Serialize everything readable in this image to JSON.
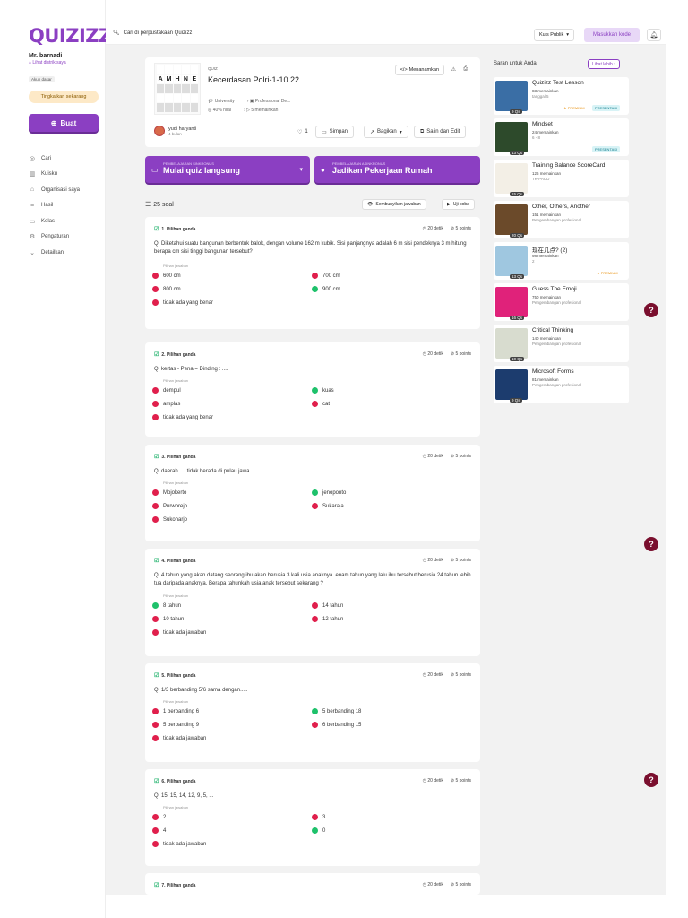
{
  "brand": {
    "logo": "QUIZIZZ"
  },
  "user": {
    "name": "Mr. barnadi",
    "district_link": "Lihat distrik saya",
    "account_type": "Akun dasar",
    "upgrade_label": "Tingkatkan sekarang"
  },
  "sidebar": {
    "create_label": "Buat",
    "items": [
      {
        "label": "Cari",
        "icon": "compass-icon"
      },
      {
        "label": "Kuisku",
        "icon": "library-icon"
      },
      {
        "label": "Organisasi saya",
        "icon": "school-icon"
      },
      {
        "label": "Hasil",
        "icon": "report-icon"
      },
      {
        "label": "Kelas",
        "icon": "class-icon"
      },
      {
        "label": "Pengaturan",
        "icon": "settings-icon"
      },
      {
        "label": "Detailkan",
        "icon": "chevron-down-icon"
      }
    ]
  },
  "topbar": {
    "search_text": "Cari di perpustakaan Quizizz",
    "public_label": "Kuis Publik",
    "code_button": "Masukkan kode"
  },
  "quiz": {
    "type_label": "QUIZ",
    "title": "Kecerdasan Polri-1-10 22",
    "thumb_letters": [
      "A",
      "M",
      "H",
      "N",
      "E"
    ],
    "level": "University",
    "category": "Professional De...",
    "accuracy": "40% nilai",
    "plays": "5 memainkan",
    "author_name": "yudi haryanti",
    "author_time": "4 bulan",
    "embed_label": "Menanamkan",
    "likes": "1",
    "save_label": "Simpan",
    "share_label": "Bagikan",
    "copy_edit_label": "Salin dan Edit"
  },
  "actions": {
    "live_sub": "PEMBELAJARAN SINKRONUS",
    "live_main": "Mulai quiz langsung",
    "hw_sub": "PEMBELAJARAN ASINKRONUS",
    "hw_main": "Jadikan Pekerjaan Rumah"
  },
  "questions_header": {
    "count": "25 soal",
    "hide_answers": "Sembunyikan jawaban",
    "try_label": "Uji coba"
  },
  "answer_choices_label": "Pilihan jawaban",
  "questions": [
    {
      "title": "1. Pilihan ganda",
      "time": "20 detik",
      "points": "5 points",
      "text": "Diketahui suatu bangunan berbentuk balok, dengan volume 162 m kubik. Sisi panjangnya adalah 6 m sisi pendeknya 3 m hitung berapa cm sisi tinggi bangunan tersebut?",
      "options": [
        {
          "label": "600 cm",
          "correct": false
        },
        {
          "label": "700 cm",
          "correct": false
        },
        {
          "label": "800 cm",
          "correct": false
        },
        {
          "label": "900 cm",
          "correct": true
        },
        {
          "label": "tidak ada yang benar",
          "correct": false
        }
      ]
    },
    {
      "title": "2. Pilihan ganda",
      "time": "20 detik",
      "points": "5 points",
      "text": "kertas - Pena = Dinding : ....",
      "options": [
        {
          "label": "dempul",
          "correct": false
        },
        {
          "label": "kuas",
          "correct": true
        },
        {
          "label": "amplas",
          "correct": false
        },
        {
          "label": "cat",
          "correct": false
        },
        {
          "label": "tidak ada yang benar",
          "correct": false
        }
      ]
    },
    {
      "title": "3. Pilihan ganda",
      "time": "20 detik",
      "points": "5 points",
      "text": "daerah..... tidak berada di pulau jawa",
      "options": [
        {
          "label": "Mojokerto",
          "correct": false
        },
        {
          "label": "jenoponto",
          "correct": true
        },
        {
          "label": "Purworejo",
          "correct": false
        },
        {
          "label": "Sukaraja",
          "correct": false
        },
        {
          "label": "Sukoharjo",
          "correct": false
        }
      ]
    },
    {
      "title": "4. Pilihan ganda",
      "time": "20 detik",
      "points": "5 points",
      "text": "4 tahun yang akan datang seorang ibu akan berusia 3 kali usia anaknya. enam tahun yang lalu ibu tersebut berusia 24 tahun lebih tua daripada anaknya. Berapa tahunkah usia anak tersebut sekarang ?",
      "options": [
        {
          "label": "8 tahun",
          "correct": true
        },
        {
          "label": "14 tahun",
          "correct": false
        },
        {
          "label": "10 tahun",
          "correct": false
        },
        {
          "label": "12 tahun",
          "correct": false
        },
        {
          "label": "tidak ada jawaban",
          "correct": false
        }
      ]
    },
    {
      "title": "5. Pilihan ganda",
      "time": "20 detik",
      "points": "5 points",
      "text": "1/3 berbanding 5/6 sama dengan.....",
      "options": [
        {
          "label": "1 berbanding 6",
          "correct": false
        },
        {
          "label": "5 berbanding 18",
          "correct": true
        },
        {
          "label": "5 berbanding 9",
          "correct": false
        },
        {
          "label": "6 berbanding 15",
          "correct": false
        },
        {
          "label": "tidak ada jawaban",
          "correct": false
        }
      ]
    },
    {
      "title": "6. Pilihan ganda",
      "time": "20 detik",
      "points": "5 points",
      "text": "15, 15, 14, 12, 9, 5, ...",
      "options": [
        {
          "label": "2",
          "correct": false
        },
        {
          "label": "3",
          "correct": false
        },
        {
          "label": "4",
          "correct": false
        },
        {
          "label": "0",
          "correct": true
        },
        {
          "label": "tidak ada jawaban",
          "correct": false
        }
      ]
    },
    {
      "title": "7. Pilihan ganda",
      "time": "20 detik",
      "points": "5 points",
      "text": "",
      "options": []
    }
  ],
  "recommendations": {
    "title": "Saran untuk Anda",
    "see_more": "Lihat lebih",
    "items": [
      {
        "name": "Quizizz Test Lesson",
        "plays": "83 memainkan",
        "grade": "tanggal 5",
        "qs": "9 Qs",
        "premium": "PREMIUM",
        "presentation": "PRESENTASI",
        "color": "#3a6ea5"
      },
      {
        "name": "Mindset",
        "plays": "24 memainkan",
        "grade": "6 - 8",
        "qs": "13 Qs",
        "premium": "",
        "presentation": "PRESENTASI",
        "color": "#2d4a2b"
      },
      {
        "name": "Training Balance ScoreCard",
        "plays": "126 memainkan",
        "grade": "TK-PAUD",
        "qs": "15 Qs",
        "premium": "",
        "presentation": "",
        "color": "#f3efe6"
      },
      {
        "name": "Other, Others, Another",
        "plays": "151 memainkan",
        "grade": "Pengembangan profesional",
        "qs": "20 Qs",
        "premium": "",
        "presentation": "",
        "color": "#6b4a2a"
      },
      {
        "name": "现在几点? (2)",
        "plays": "98 memainkan",
        "grade": "2",
        "qs": "13 Qs",
        "premium": "PREMIUM",
        "presentation": "",
        "color": "#9fc7e0"
      },
      {
        "name": "Guess The Emoji",
        "plays": "750 memainkan",
        "grade": "Pengembangan profesional",
        "qs": "16 Qs",
        "premium": "",
        "presentation": "",
        "color": "#e0227a"
      },
      {
        "name": "Critical Thinking",
        "plays": "140 memainkan",
        "grade": "Pengembangan profesional",
        "qs": "10 Qs",
        "premium": "",
        "presentation": "",
        "color": "#d8dccf"
      },
      {
        "name": "Microsoft Forms",
        "plays": "81 memainkan",
        "grade": "Pengembangan profesional",
        "qs": "9 Qs",
        "premium": "",
        "presentation": "",
        "color": "#1c3c6e"
      }
    ]
  },
  "help_label": "?"
}
